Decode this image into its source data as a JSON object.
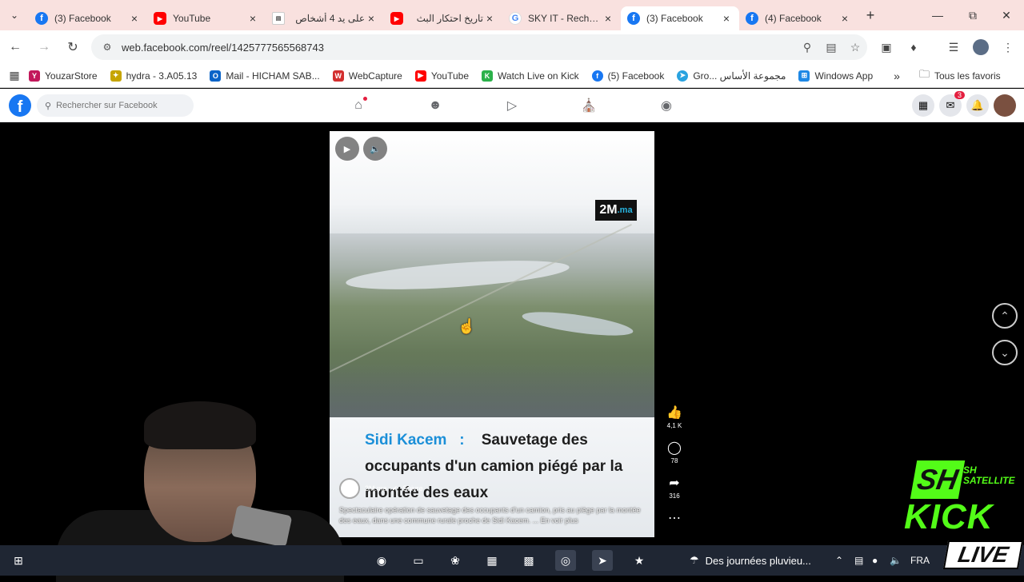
{
  "browser": {
    "tabs": [
      {
        "title": "(3) Facebook",
        "icon": "facebook-icon",
        "active": false
      },
      {
        "title": "YouTube",
        "icon": "youtube-icon",
        "active": false
      },
      {
        "title": "على يد 4 أشخاص",
        "icon": "news-icon",
        "active": false
      },
      {
        "title": "تاريخ احتكار البث",
        "icon": "youtube-icon",
        "active": false
      },
      {
        "title": "SKY IT - Recherc",
        "icon": "google-icon",
        "active": false
      },
      {
        "title": "(3) Facebook",
        "icon": "facebook-icon",
        "active": true
      },
      {
        "title": "(4) Facebook",
        "icon": "facebook-icon",
        "active": false
      }
    ],
    "url": "web.facebook.com/reel/1425777565568743",
    "bookmarks": [
      {
        "label": "YouzarStore",
        "icon": "yahoo-icon",
        "color": "#c2185b"
      },
      {
        "label": "hydra - 3.A05.13",
        "icon": "hydra-icon",
        "color": "#c6a500"
      },
      {
        "label": "Mail - HICHAM SAB...",
        "icon": "outlook-icon",
        "color": "#0a64c8"
      },
      {
        "label": "WebCapture",
        "icon": "webcapture-icon",
        "color": "#d32f2f"
      },
      {
        "label": "YouTube",
        "icon": "youtube-icon",
        "color": "#ff0000"
      },
      {
        "label": "Watch Live on Kick",
        "icon": "kick-icon",
        "color": "#2bb14a"
      },
      {
        "label": "(5) Facebook",
        "icon": "facebook-icon",
        "color": "#1877f2"
      },
      {
        "label": "Gro... مجموعة الأساس",
        "icon": "telegram-icon",
        "color": "#2aa3e0"
      },
      {
        "label": "Windows App",
        "icon": "windows-icon",
        "color": "#1e88e5"
      }
    ],
    "all_bookmarks": "Tous les favoris"
  },
  "facebook": {
    "search_placeholder": "Rechercher sur Facebook",
    "notification_count": "3"
  },
  "reel": {
    "channel_logo": "2M",
    "channel_logo_suffix": ".ma",
    "caption_city": "Sidi Kacem",
    "caption_colon": ":",
    "caption_line1_rest": "Sauvetage des",
    "caption_line2": "occupants d'un camion piégé par la",
    "caption_line3": "montée des eaux",
    "author": "2M.ma",
    "follow": "Suivre",
    "description": "Spectaculaire opération de sauvetage des occupants d'un camion, pris au piège par la montée des eaux, dans une commune rurale proche de Sidi Kacem.",
    "see_more": "... En voir plus",
    "likes": "4,1 K",
    "comments": "78",
    "shares": "316"
  },
  "taskbar": {
    "weather": "Des journées pluvieu...",
    "language": "FRA"
  },
  "overlay": {
    "brand_short": "SH",
    "brand_small": "SH",
    "brand_sub": "SATELLITE",
    "kick": "KICK",
    "live": "LIVE"
  }
}
